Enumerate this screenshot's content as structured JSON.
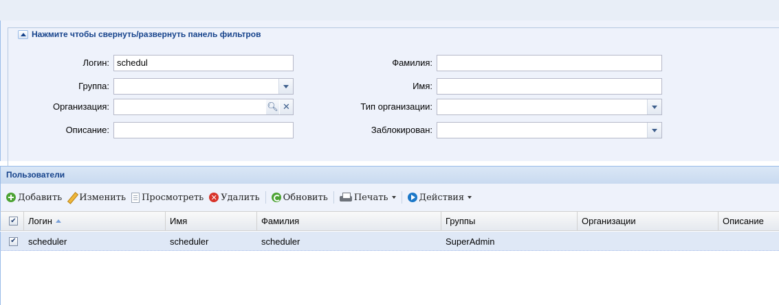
{
  "filter_panel": {
    "toggle_label": "Нажмите чтобы свернуть/развернуть панель фильтров",
    "fields": {
      "login": {
        "label": "Логин:",
        "value": "schedul"
      },
      "group": {
        "label": "Группа:",
        "value": ""
      },
      "organization": {
        "label": "Организация:",
        "value": ""
      },
      "description": {
        "label": "Описание:",
        "value": ""
      },
      "last_name": {
        "label": "Фамилия:",
        "value": ""
      },
      "first_name": {
        "label": "Имя:",
        "value": ""
      },
      "org_type": {
        "label": "Тип организации:",
        "value": ""
      },
      "blocked": {
        "label": "Заблокирован:",
        "value": ""
      }
    }
  },
  "users_panel": {
    "title": "Пользователи",
    "toolbar": {
      "add": "Добавить",
      "edit": "Изменить",
      "view": "Просмотреть",
      "delete": "Удалить",
      "refresh": "Обновить",
      "print": "Печать",
      "actions": "Действия"
    },
    "columns": [
      "Логин",
      "Имя",
      "Фамилия",
      "Группы",
      "Организации",
      "Описание"
    ],
    "sort_column": "Логин",
    "sort_direction": "asc",
    "rows": [
      {
        "checked": true,
        "login": "scheduler",
        "first_name": "scheduler",
        "last_name": "scheduler",
        "groups": "SuperAdmin",
        "organizations": "",
        "description": ""
      }
    ]
  },
  "colors": {
    "panel_header_text": "#15428b",
    "selected_row_bg": "#dfe8f6",
    "filter_bg": "#eef2fb"
  }
}
